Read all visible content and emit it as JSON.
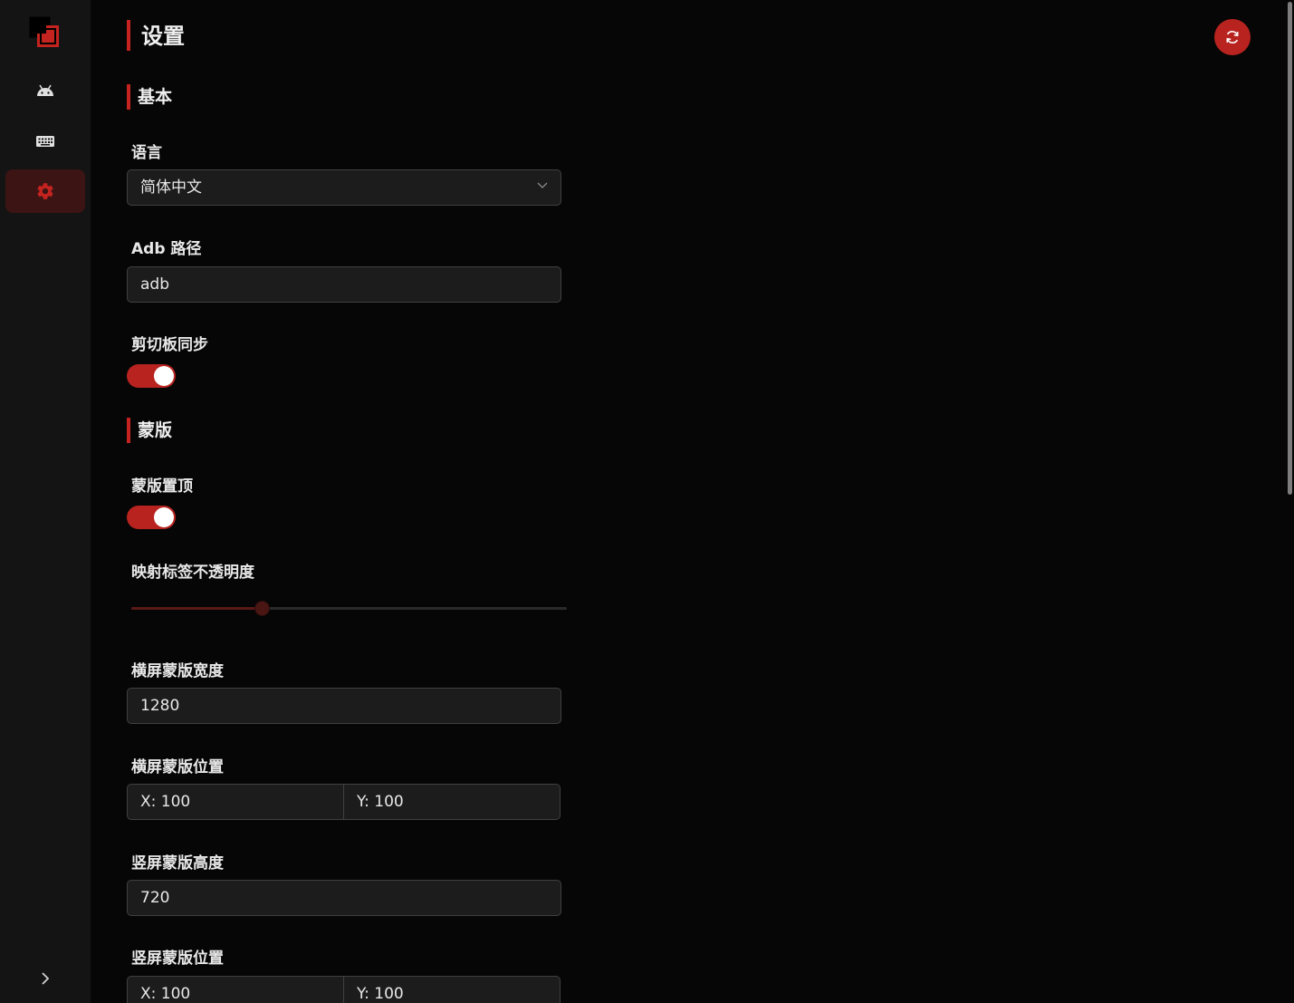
{
  "page": {
    "title": "设置"
  },
  "sidebar": {
    "items": [
      {
        "icon": "android-icon",
        "active": false
      },
      {
        "icon": "keyboard-icon",
        "active": false
      },
      {
        "icon": "gear-icon",
        "active": true
      }
    ]
  },
  "sections": {
    "basic": {
      "title": "基本"
    },
    "mask": {
      "title": "蒙版"
    }
  },
  "language": {
    "label": "语言",
    "value": "简体中文"
  },
  "adb": {
    "label": "Adb 路径",
    "value": "adb"
  },
  "clipboard": {
    "label": "剪切板同步",
    "enabled": true
  },
  "mask_on_top": {
    "label": "蒙版置顶",
    "enabled": true
  },
  "label_opacity": {
    "label": "映射标签不透明度",
    "value": 0.3
  },
  "landscape_width": {
    "label": "横屏蒙版宽度",
    "value": "1280"
  },
  "landscape_position": {
    "label": "横屏蒙版位置",
    "x": "X: 100",
    "y": "Y: 100"
  },
  "portrait_height": {
    "label": "竖屏蒙版高度",
    "value": "720"
  },
  "portrait_position": {
    "label": "竖屏蒙版位置",
    "x": "X: 100",
    "y": "Y: 100"
  },
  "colors": {
    "accent": "#b8231f",
    "background": "#060606",
    "sidebar": "#141414"
  }
}
